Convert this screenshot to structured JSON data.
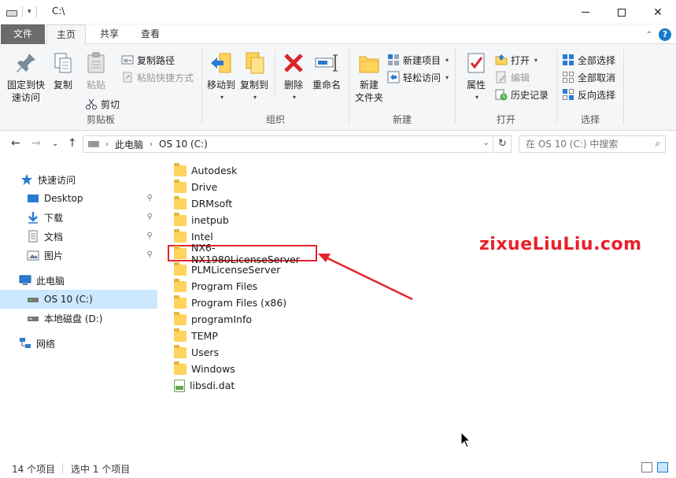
{
  "window": {
    "title": "C:\\",
    "min_icon": "minimize-icon",
    "max_icon": "maximize-icon",
    "close_icon": "close-icon",
    "close_glyph": "✕"
  },
  "tabs": {
    "file": "文件",
    "home": "主页",
    "share": "共享",
    "view": "查看",
    "help": "?"
  },
  "ribbon": {
    "clipboard": {
      "label": "剪贴板",
      "pin": "固定到快\n速访问",
      "pin_l1": "固定到快",
      "pin_l2": "速访问",
      "copy": "复制",
      "paste": "粘贴",
      "copy_path": "复制路径",
      "paste_shortcut": "粘贴快捷方式",
      "cut": "剪切"
    },
    "organize": {
      "label": "组织",
      "move_to": "移动到",
      "copy_to": "复制到",
      "delete": "删除",
      "rename": "重命名"
    },
    "new": {
      "label": "新建",
      "new_folder_l1": "新建",
      "new_folder_l2": "文件夹",
      "new_item": "新建项目",
      "easy_access": "轻松访问"
    },
    "open": {
      "label": "打开",
      "properties": "属性",
      "open": "打开",
      "edit": "编辑",
      "history": "历史记录"
    },
    "select": {
      "label": "选择",
      "select_all": "全部选择",
      "select_none": "全部取消",
      "invert": "反向选择"
    }
  },
  "address": {
    "crumbs": [
      "此电脑",
      "OS 10 (C:)"
    ],
    "search_placeholder": "在 OS 10 (C:) 中搜索"
  },
  "nav": {
    "quick_access": "快速访问",
    "desktop": "Desktop",
    "downloads": "下载",
    "documents": "文档",
    "pictures": "图片",
    "this_pc": "此电脑",
    "os_drive": "OS 10 (C:)",
    "local_disk": "本地磁盘 (D:)",
    "network": "网络"
  },
  "files": [
    {
      "name": "Autodesk",
      "type": "folder"
    },
    {
      "name": "Drive",
      "type": "folder"
    },
    {
      "name": "DRMsoft",
      "type": "folder"
    },
    {
      "name": "inetpub",
      "type": "folder"
    },
    {
      "name": "Intel",
      "type": "folder"
    },
    {
      "name": "NX6-NX1980LicenseServer",
      "type": "folder",
      "highlighted": true
    },
    {
      "name": "PLMLicenseServer",
      "type": "folder"
    },
    {
      "name": "Program Files",
      "type": "folder"
    },
    {
      "name": "Program Files (x86)",
      "type": "folder"
    },
    {
      "name": "programInfo",
      "type": "folder"
    },
    {
      "name": "TEMP",
      "type": "folder"
    },
    {
      "name": "Users",
      "type": "folder"
    },
    {
      "name": "Windows",
      "type": "folder"
    },
    {
      "name": "libsdi.dat",
      "type": "dat"
    }
  ],
  "watermark": "zixueLiuLiu.com",
  "status": {
    "count": "14 个项目",
    "selected": "选中 1 个项目"
  },
  "colors": {
    "accent": "#1979ca",
    "highlight_red": "#e4242b",
    "selected_bg": "#cce8ff",
    "folder": "#ffd35c"
  }
}
